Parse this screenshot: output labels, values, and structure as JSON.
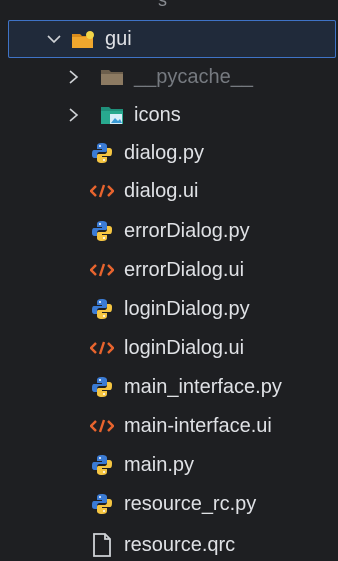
{
  "tree": {
    "cut_off_label": "s",
    "root": {
      "label": "gui",
      "expanded": true,
      "icon": "folder-gui-icon"
    },
    "items": [
      {
        "label": "__pycache__",
        "type": "folder",
        "icon": "folder-icon",
        "muted": true
      },
      {
        "label": "icons",
        "type": "folder",
        "icon": "image-folder-icon",
        "muted": false
      },
      {
        "label": "dialog.py",
        "type": "python",
        "icon": "python-icon"
      },
      {
        "label": "dialog.ui",
        "type": "ui",
        "icon": "code-tag-icon"
      },
      {
        "label": "errorDialog.py",
        "type": "python",
        "icon": "python-icon"
      },
      {
        "label": "errorDialog.ui",
        "type": "ui",
        "icon": "code-tag-icon"
      },
      {
        "label": "loginDialog.py",
        "type": "python",
        "icon": "python-icon"
      },
      {
        "label": "loginDialog.ui",
        "type": "ui",
        "icon": "code-tag-icon"
      },
      {
        "label": "main_interface.py",
        "type": "python",
        "icon": "python-icon"
      },
      {
        "label": "main-interface.ui",
        "type": "ui",
        "icon": "code-tag-icon"
      },
      {
        "label": "main.py",
        "type": "python",
        "icon": "python-icon"
      },
      {
        "label": "resource_rc.py",
        "type": "python",
        "icon": "python-icon"
      },
      {
        "label": "resource.qrc",
        "type": "file",
        "icon": "file-icon"
      }
    ]
  },
  "colors": {
    "background": "#1e1f22",
    "selection_border": "#3f73c6",
    "text": "#dfe1e5",
    "muted_text": "#767a80",
    "ui_icon": "#e8642e",
    "python_blue": "#3b7bd4",
    "python_yellow": "#f5c542"
  }
}
